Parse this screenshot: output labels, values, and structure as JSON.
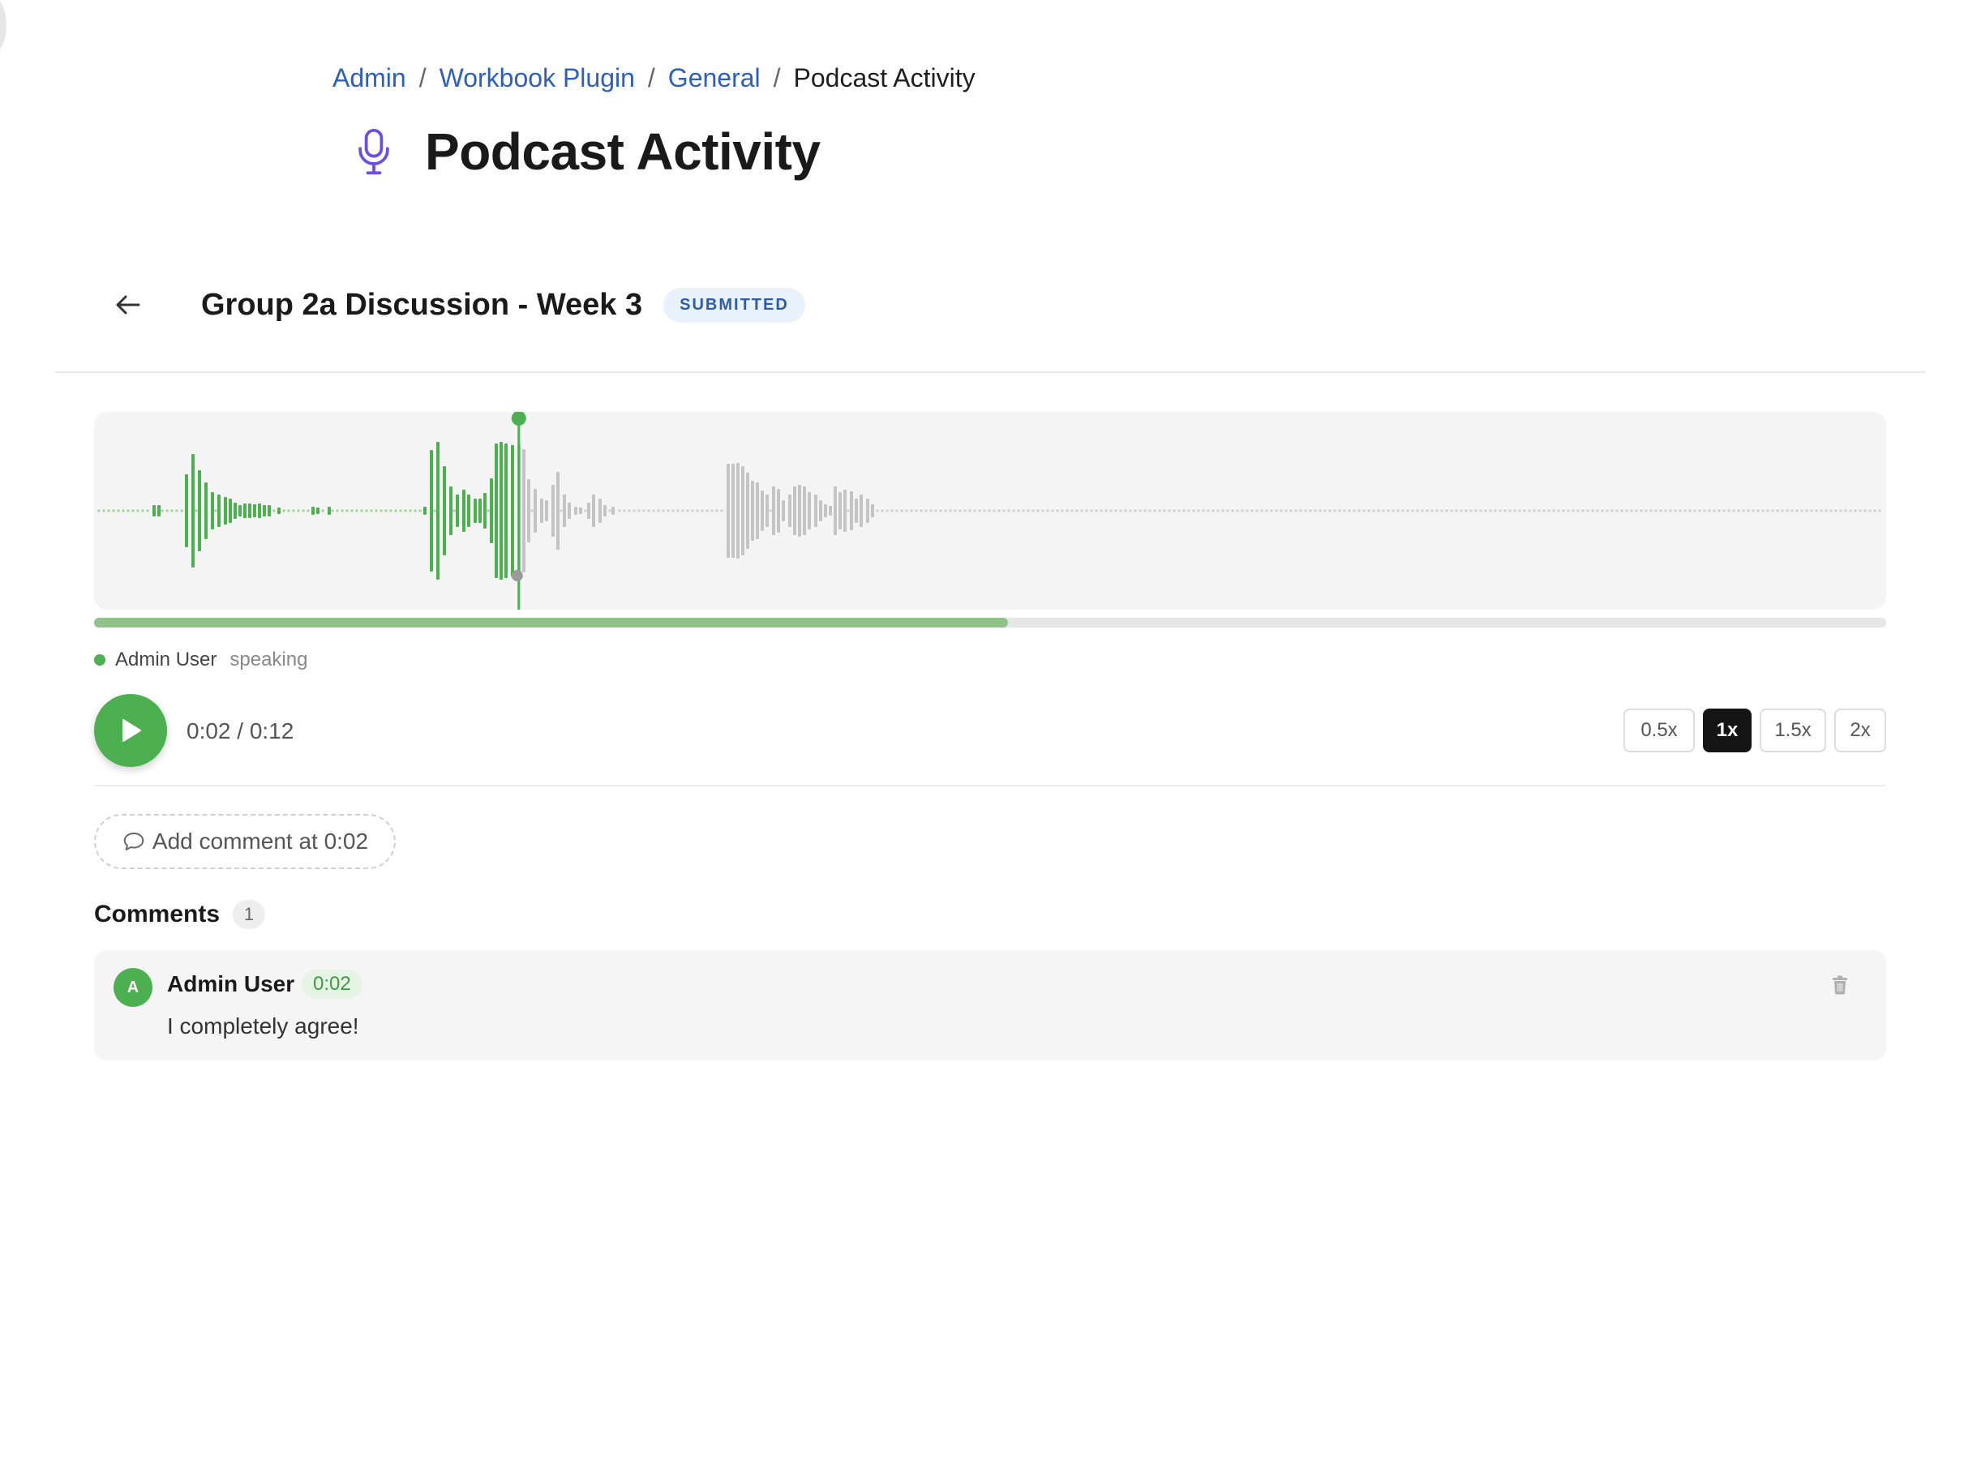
{
  "breadcrumb": {
    "items": [
      "Admin",
      "Workbook Plugin",
      "General"
    ],
    "separator": "/",
    "current": "Podcast Activity"
  },
  "page": {
    "title": "Podcast Activity",
    "icon": "microphone-icon",
    "accent_color": "#6c4ee6"
  },
  "activity": {
    "back_icon": "arrow-left-icon",
    "title": "Group 2a Discussion - Week 3",
    "status": "SUBMITTED"
  },
  "player": {
    "progress_fraction": 0.51,
    "playhead_fraction": 0.237,
    "played_color": "#4caf50",
    "unplayed_color": "#c4c4c4",
    "speaker": {
      "name": "Admin User",
      "status": "speaking"
    },
    "time": "0:02 / 0:12",
    "play_icon": "play-icon",
    "speeds": [
      "0.5x",
      "1x",
      "1.5x",
      "2x"
    ],
    "active_speed": "1x"
  },
  "add_comment": {
    "icon": "chat-bubble-icon",
    "label": "Add comment at 0:02"
  },
  "comments": {
    "title": "Comments",
    "count": "1",
    "items": [
      {
        "avatar": "A",
        "author": "Admin User",
        "timestamp": "0:02",
        "text": "I completely agree!",
        "delete_icon": "trash-icon"
      }
    ]
  }
}
